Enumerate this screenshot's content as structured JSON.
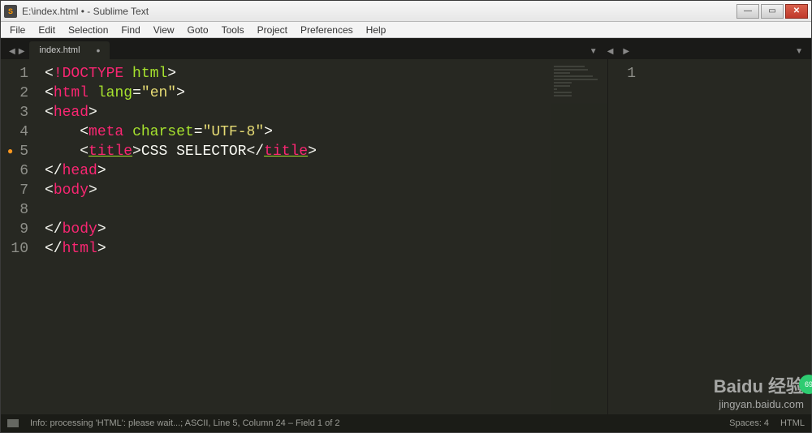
{
  "window": {
    "title": "E:\\index.html • - Sublime Text"
  },
  "menubar": [
    "File",
    "Edit",
    "Selection",
    "Find",
    "View",
    "Goto",
    "Tools",
    "Project",
    "Preferences",
    "Help"
  ],
  "tab": {
    "label": "index.html",
    "dirty": "•"
  },
  "gutter_left": [
    "1",
    "2",
    "3",
    "4",
    "5",
    "6",
    "7",
    "8",
    "9",
    "10"
  ],
  "gutter_right": [
    "1"
  ],
  "code_title_text": "CSS SELECTOR",
  "code_lang": "en",
  "code_charset": "UTF-8",
  "statusbar": {
    "info": "Info: processing 'HTML': please wait...; ASCII, Line 5, Column 24 – Field 1 of 2",
    "spaces": "Spaces: 4",
    "syntax": "HTML"
  },
  "watermark": {
    "main": "Baidu 经验",
    "sub": "jingyan.baidu.com"
  }
}
